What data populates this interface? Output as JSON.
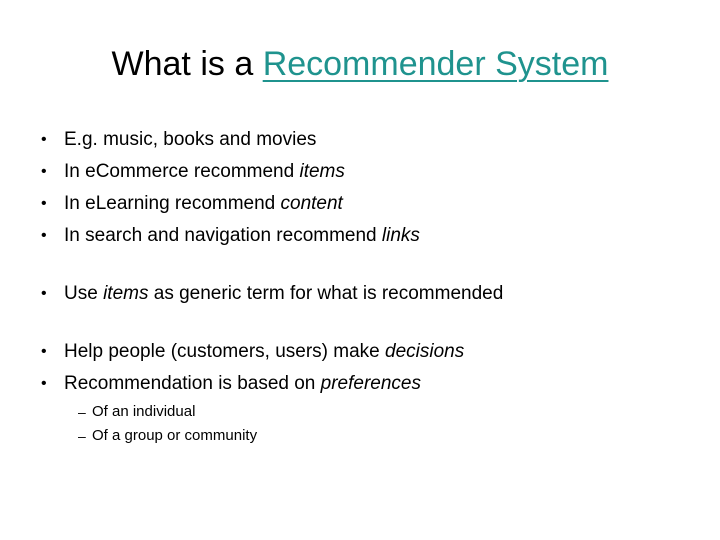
{
  "slide": {
    "background_color": "#FFFFFF",
    "accent_color": "#1F938E",
    "text_color": "#000000",
    "title": {
      "plain_part": "What is a ",
      "accent_part": "Recommender System"
    },
    "bullet_marker": "•",
    "sub_bullet_marker": "–",
    "bullets_group_1": [
      {
        "marker": "•",
        "segments": [
          {
            "text": "E.g. music, books and movies",
            "italic": false
          }
        ]
      },
      {
        "marker": "•",
        "segments": [
          {
            "text": "In eCommerce recommend ",
            "italic": false
          },
          {
            "text": "items",
            "italic": true
          }
        ]
      },
      {
        "marker": "•",
        "segments": [
          {
            "text": "In eLearning recommend ",
            "italic": false
          },
          {
            "text": "content",
            "italic": true
          }
        ]
      },
      {
        "marker": "•",
        "segments": [
          {
            "text": "In search and navigation recommend ",
            "italic": false
          },
          {
            "text": "links",
            "italic": true
          }
        ]
      }
    ],
    "bullets_group_2": [
      {
        "marker": "•",
        "segments": [
          {
            "text": "Use ",
            "italic": false
          },
          {
            "text": "items",
            "italic": true
          },
          {
            "text": " as generic term for what is recommended",
            "italic": false
          }
        ]
      }
    ],
    "bullets_group_3": [
      {
        "marker": "•",
        "segments": [
          {
            "text": "Help people (customers, users) make ",
            "italic": false
          },
          {
            "text": "decisions",
            "italic": true
          }
        ]
      },
      {
        "marker": "•",
        "segments": [
          {
            "text": "Recommendation is based on ",
            "italic": false
          },
          {
            "text": "preferences",
            "italic": true
          }
        ]
      }
    ],
    "sub_bullets": [
      {
        "marker": "–",
        "segments": [
          {
            "text": "Of an individual",
            "italic": false
          }
        ]
      },
      {
        "marker": "–",
        "segments": [
          {
            "text": "Of a group or community",
            "italic": false
          }
        ]
      }
    ]
  }
}
